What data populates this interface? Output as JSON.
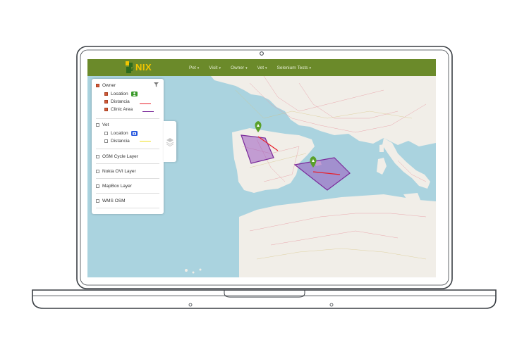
{
  "app": {
    "logo_prefix": "pv",
    "logo_text": "NIX"
  },
  "nav": {
    "items": [
      {
        "label": "Pet"
      },
      {
        "label": "Visit"
      },
      {
        "label": "Owner"
      },
      {
        "label": "Vet"
      },
      {
        "label": "Selenium Tests"
      }
    ]
  },
  "layers": {
    "owner": {
      "label": "Owner",
      "checked": true,
      "children": [
        {
          "label": "Location",
          "checked": true,
          "icon": "person-marker-icon",
          "color": "#3a9a2a"
        },
        {
          "label": "Distancia",
          "checked": true,
          "icon": "line-swatch",
          "color": "#e8202a"
        },
        {
          "label": "Clinic Area",
          "checked": true,
          "icon": "line-swatch",
          "color": "#7a2a9a"
        }
      ]
    },
    "vet": {
      "label": "Vet",
      "checked": false,
      "children": [
        {
          "label": "Location",
          "checked": false,
          "icon": "camera-marker-icon",
          "color": "#2a5adf"
        },
        {
          "label": "Distancia",
          "checked": false,
          "icon": "line-swatch",
          "color": "#f0e020"
        }
      ]
    },
    "base": [
      {
        "label": "OSM Cycle Layer",
        "checked": false
      },
      {
        "label": "Nokia OVI Layer",
        "checked": false
      },
      {
        "label": "MapBox Layer",
        "checked": false
      },
      {
        "label": "WMS OSM",
        "checked": false
      }
    ]
  },
  "colors": {
    "navbar": "#6b8a2a",
    "marker": "#5aa02a",
    "area_fill": "#9a5abf",
    "area_stroke": "#7a2a9a",
    "distance_line": "#e8202a"
  }
}
